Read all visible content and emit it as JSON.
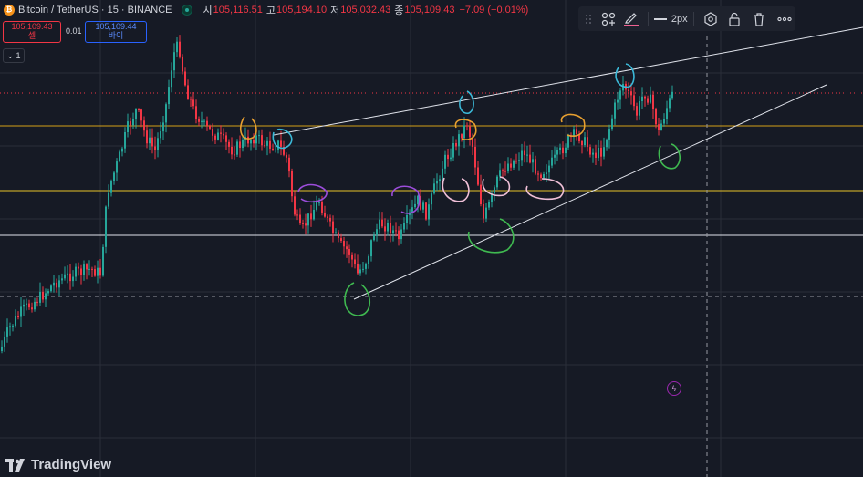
{
  "header": {
    "symbol_title": "Bitcoin / TetherUS · 15 · BINANCE",
    "coin_icon": "bitcoin-icon",
    "ohlc": [
      {
        "label": "시",
        "value": "105,116.51"
      },
      {
        "label": "고",
        "value": "105,194.10"
      },
      {
        "label": "저",
        "value": "105,032.43"
      },
      {
        "label": "종",
        "value": "105,109.43"
      }
    ],
    "change": "−7.09 (−0.01%)"
  },
  "trade": {
    "sell_price": "105,109.43",
    "sell_label": "셀",
    "spread": "0.01",
    "buy_price": "105,109.44",
    "buy_label": "바이"
  },
  "collapse_label": "1",
  "toolbar": {
    "width_label": "2px",
    "icons": [
      "drag-handle-icon",
      "templates-icon",
      "pencil-icon",
      "line-style-icon",
      "settings-icon",
      "lock-icon",
      "trash-icon",
      "more-icon"
    ]
  },
  "logo_text": "TradingView",
  "colors": {
    "background": "#161a25",
    "up": "#26a69a",
    "down": "#f23645",
    "orange_line": "#d4a017",
    "yellow_line": "#e6c229",
    "white_line": "#e0e3eb"
  }
}
